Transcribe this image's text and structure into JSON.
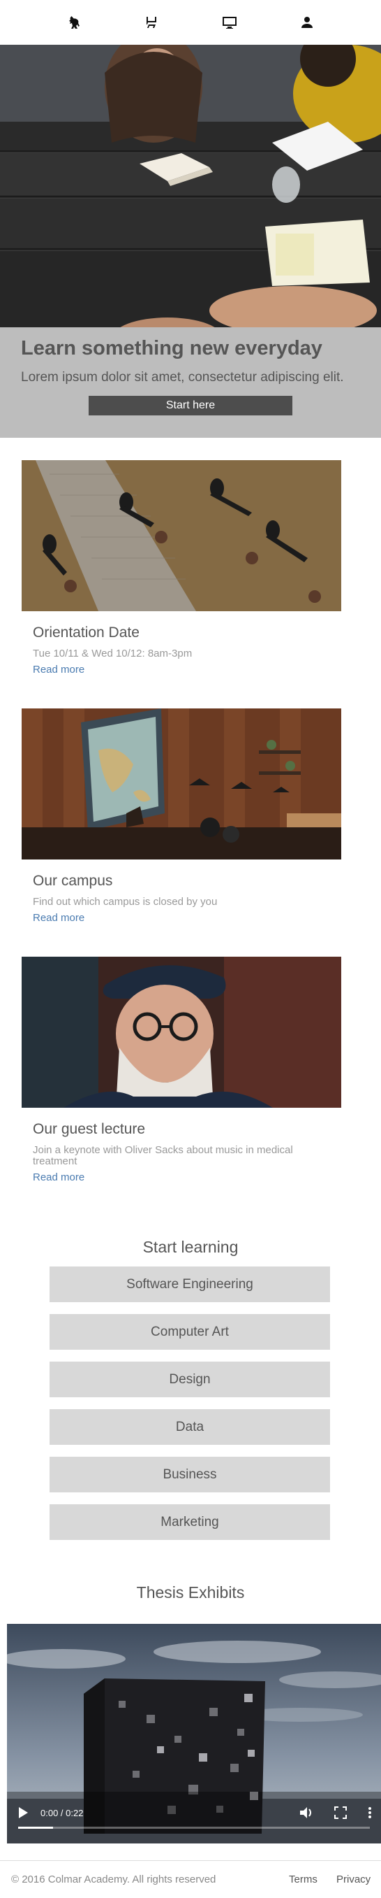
{
  "nav": {
    "items": [
      {
        "icon": "lion-icon",
        "label": ""
      },
      {
        "icon": "chair-icon",
        "label": ""
      },
      {
        "icon": "monitor-icon",
        "label": ""
      },
      {
        "icon": "person-icon",
        "label": ""
      }
    ]
  },
  "hero": {
    "title": "Learn something new everyday",
    "subtitle": "Lorem ipsum dolor sit amet, consectetur adipiscing elit.",
    "button_label": "Start here"
  },
  "cards": [
    {
      "title": "Orientation Date",
      "description": "Tue 10/11 & Wed 10/12: 8am-3pm",
      "link": "Read more"
    },
    {
      "title": "Our campus",
      "description": "Find out which campus is closed by you",
      "link": "Read more"
    },
    {
      "title": "Our guest lecture",
      "description": "Join a keynote with Oliver Sacks about music in medical treatment",
      "link": "Read more"
    }
  ],
  "learning": {
    "heading": "Start learning",
    "courses": [
      "Software Engineering",
      "Computer Art",
      "Design",
      "Data",
      "Business",
      "Marketing"
    ]
  },
  "thesis": {
    "heading": "Thesis Exhibits",
    "video_time": "0:00 / 0:22",
    "progress": 0.1
  },
  "footer": {
    "copyright": "© 2016 Colmar Academy. All rights reserved",
    "links": [
      "Terms",
      "Privacy"
    ]
  },
  "colors": {
    "hero_band": "#bdbdbd",
    "button_dark": "#4d4d4d",
    "course_bg": "#d8d8d8",
    "link": "#4a7bb0"
  }
}
